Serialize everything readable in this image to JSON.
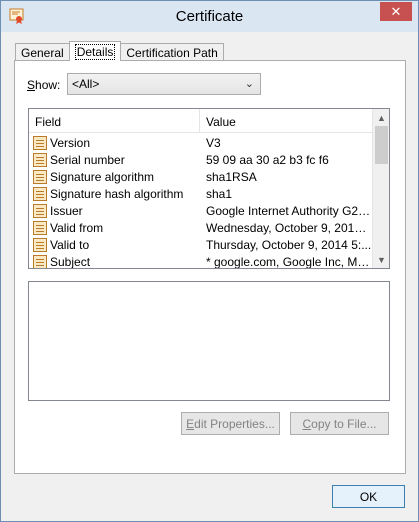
{
  "window": {
    "title": "Certificate",
    "close_label": "✕"
  },
  "tabs": [
    {
      "label": "General"
    },
    {
      "label": "Details"
    },
    {
      "label": "Certification Path"
    }
  ],
  "show": {
    "label_accel": "S",
    "label_rest": "how:",
    "selected": "<All>"
  },
  "list": {
    "columns": {
      "field": "Field",
      "value": "Value"
    },
    "rows": [
      {
        "field": "Version",
        "value": "V3"
      },
      {
        "field": "Serial number",
        "value": "59 09 aa 30 a2 b3 fc f6"
      },
      {
        "field": "Signature algorithm",
        "value": "sha1RSA"
      },
      {
        "field": "Signature hash algorithm",
        "value": "sha1"
      },
      {
        "field": "Issuer",
        "value": "Google Internet Authority G2, ..."
      },
      {
        "field": "Valid from",
        "value": "Wednesday, October 9, 2013 ..."
      },
      {
        "field": "Valid to",
        "value": "Thursday, October 9, 2014 5:..."
      },
      {
        "field": "Subject",
        "value": "* google.com, Google Inc, Mo..."
      }
    ]
  },
  "buttons": {
    "edit_accel": "E",
    "edit_rest": "dit Properties...",
    "copy_accel": "C",
    "copy_rest": "opy to File...",
    "ok": "OK"
  }
}
